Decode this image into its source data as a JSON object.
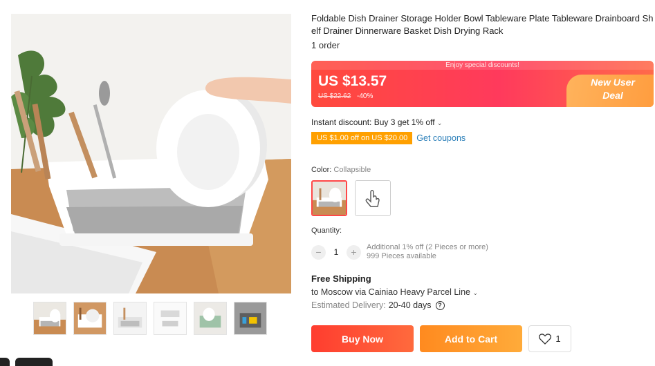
{
  "product": {
    "title": "Foldable Dish Drainer Storage Holder Bowl Tableware Plate Tableware Drainboard Shelf Drainer Dinnerware Basket Dish Drying Rack",
    "orders": "1 order"
  },
  "gallery": {
    "thumbnail_count": 6,
    "selected_thumbnail": 0
  },
  "price": {
    "promo_strip": "Enjoy special discounts!",
    "current": "US $13.57",
    "original": "US $22.62",
    "discount": "-40%",
    "deal_badge": "New User Deal"
  },
  "discount": {
    "instant_text": "Instant discount: Buy 3 get 1% off",
    "coupon_chip": "US $1.00 off on US $20.00",
    "get_coupons": "Get coupons"
  },
  "color": {
    "label": "Color:",
    "value": "Collapsible",
    "options_count": 2
  },
  "quantity": {
    "label": "Quantity:",
    "minus": "−",
    "value": "1",
    "plus": "+",
    "note_line1": "Additional 1% off (2 Pieces or more)",
    "note_line2": "999 Pieces available"
  },
  "shipping": {
    "title": "Free Shipping",
    "route": "to Moscow via Cainiao Heavy Parcel Line",
    "est_label": "Estimated Delivery:",
    "est_days": "20-40 days",
    "help": "?"
  },
  "actions": {
    "buy_now": "Buy Now",
    "add_to_cart": "Add to Cart",
    "wishlist_count": "1"
  },
  "colors": {
    "accent_red": "#ff4747",
    "price_gradient_start": "#ff4a3d",
    "coupon_orange": "#ffa000",
    "link_blue": "#2b7fb9",
    "cart_orange": "#ff8a1f"
  },
  "icons": {
    "dropdown": "chevron-down-icon",
    "help": "question-circle-icon",
    "wishlist": "heart-icon",
    "swatch2": "hand-pointer-icon"
  }
}
